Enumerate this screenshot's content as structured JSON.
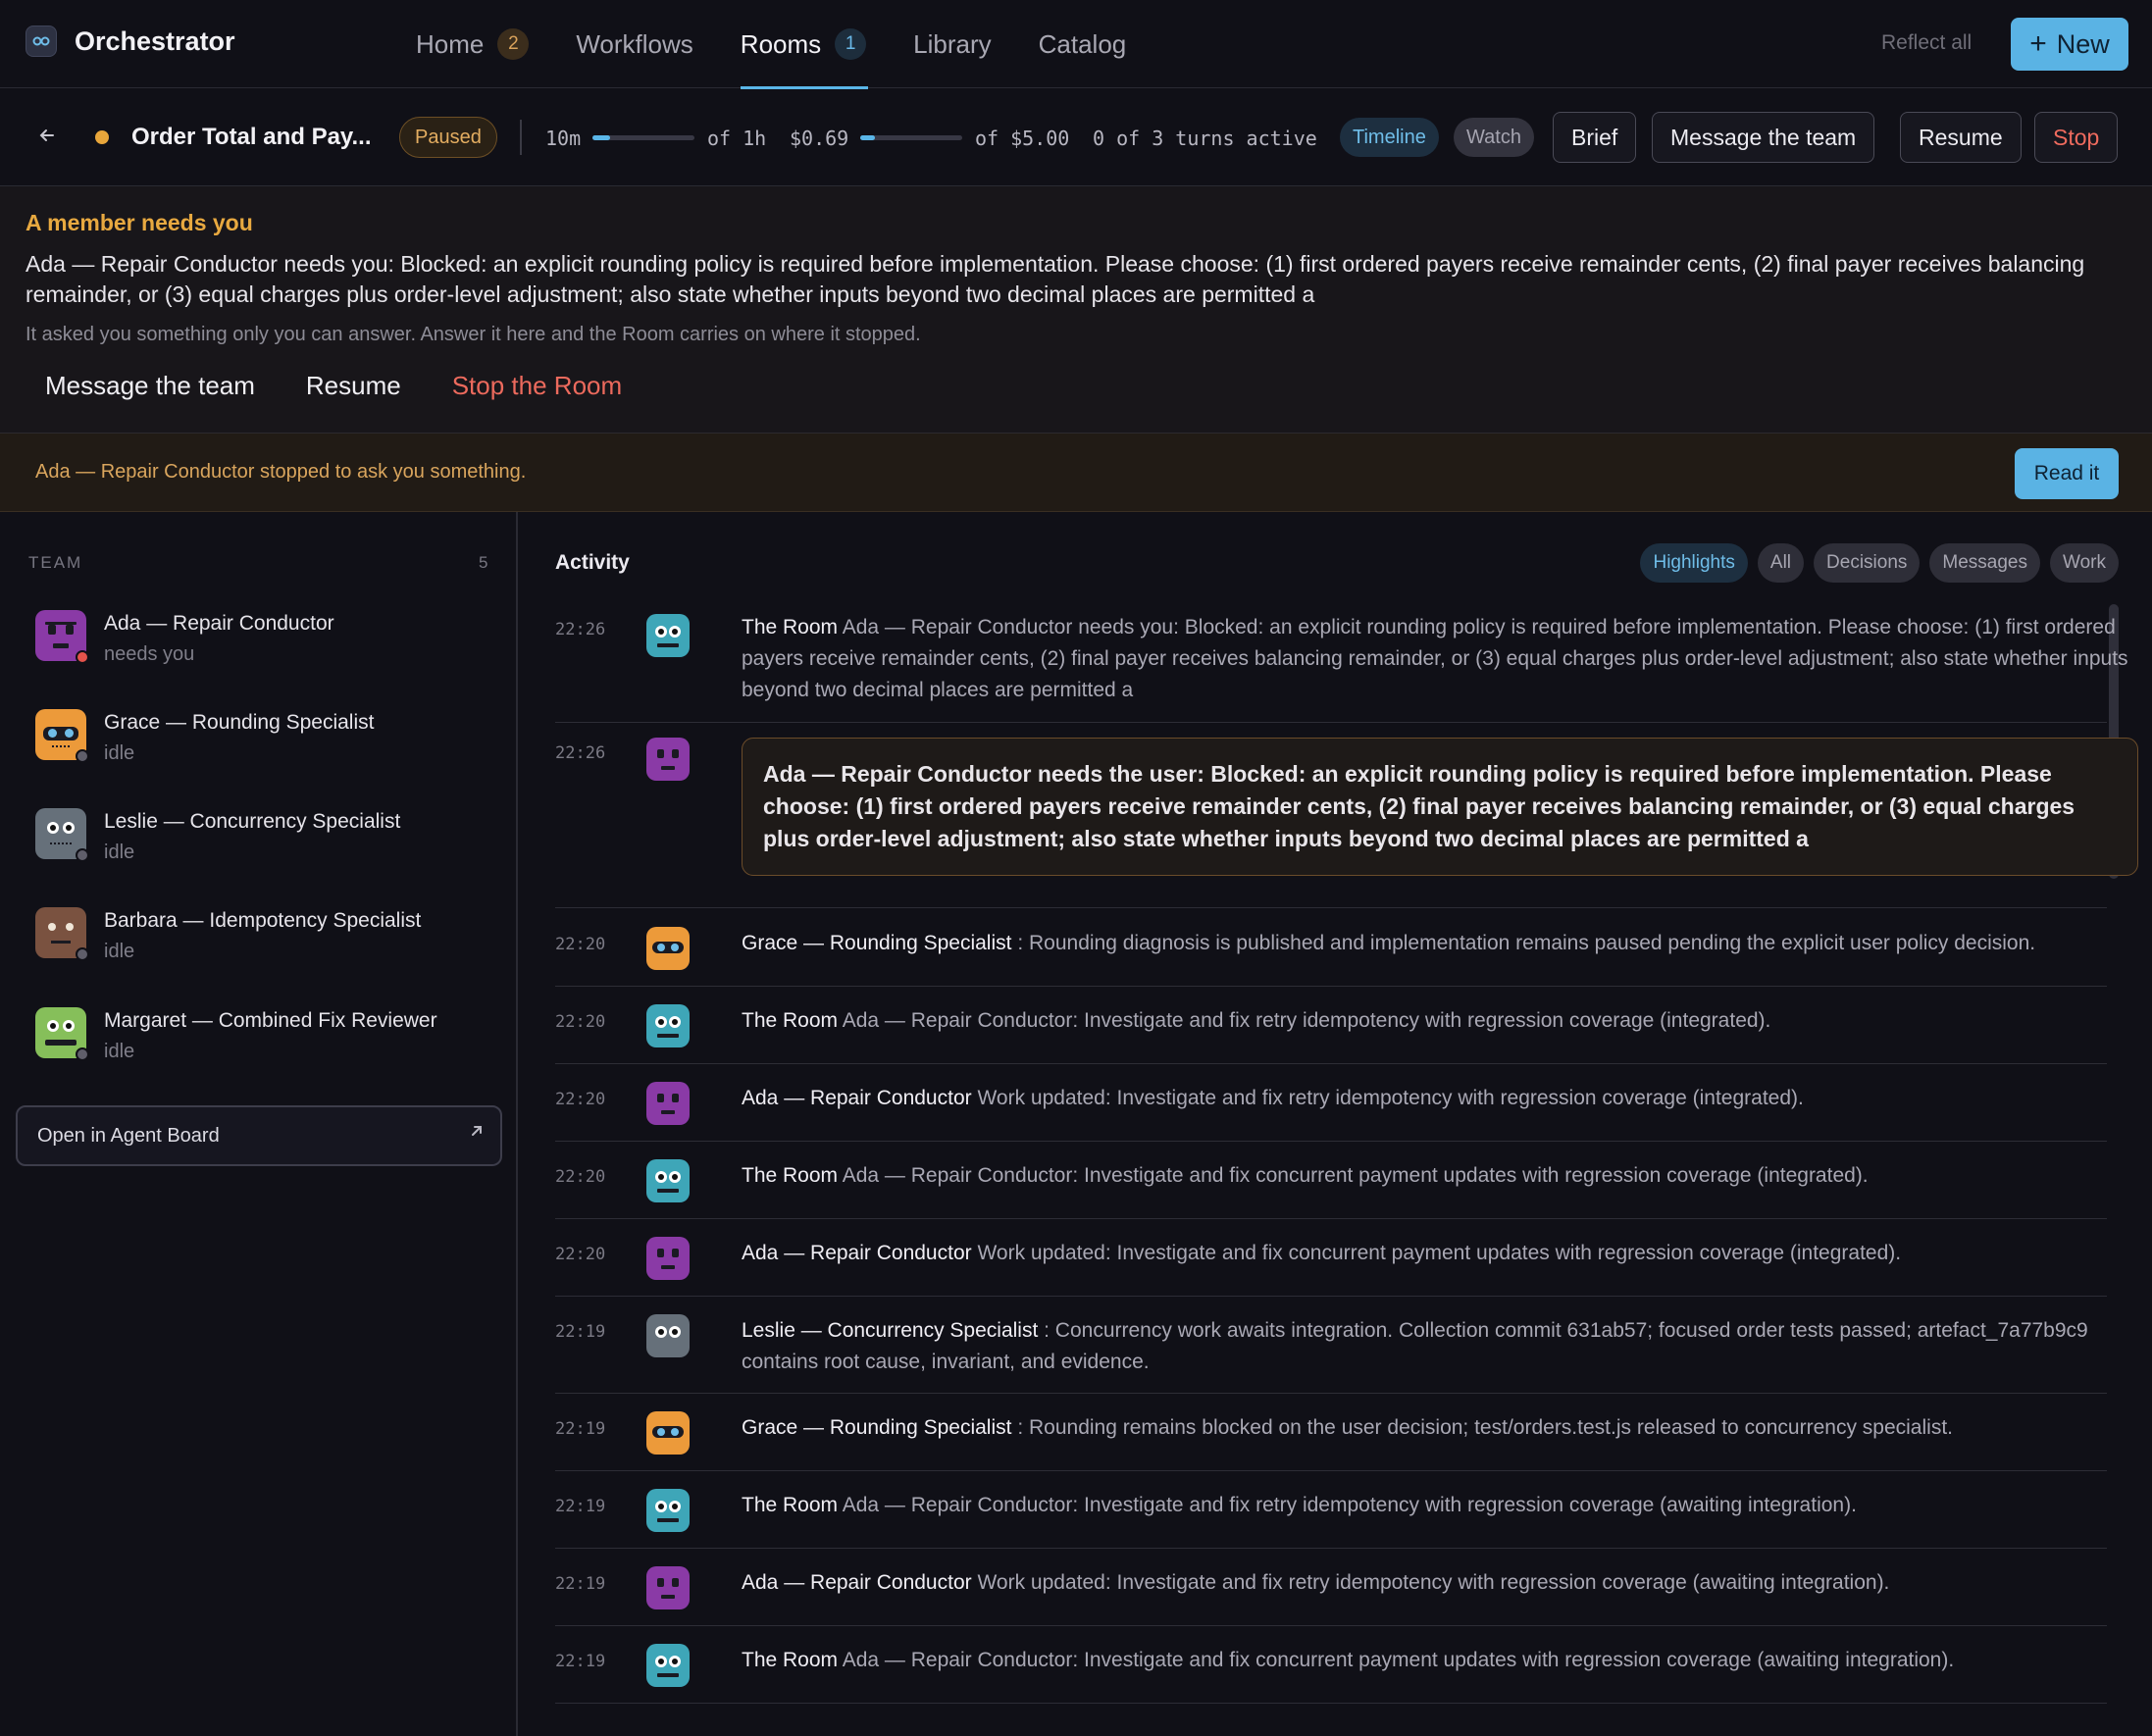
{
  "nav": {
    "brand": "Orchestrator",
    "tabs": [
      {
        "label": "Home",
        "badge": "2"
      },
      {
        "label": "Workflows"
      },
      {
        "label": "Rooms",
        "badge": "1"
      },
      {
        "label": "Library"
      },
      {
        "label": "Catalog"
      }
    ],
    "active_tab": "Rooms",
    "reflect_all": "Reflect all",
    "new_label": "New"
  },
  "room": {
    "title": "Order Total and Pay...",
    "status": "Paused",
    "time_used": "10m",
    "time_limit": "of 1h",
    "time_progress": 0.17,
    "cost_used": "$0.69",
    "cost_limit": "of $5.00",
    "cost_progress": 0.14,
    "turns": "0 of 3 turns active",
    "timeline": "Timeline",
    "watch": "Watch",
    "brief": "Brief",
    "message_team": "Message the team",
    "resume": "Resume",
    "stop": "Stop"
  },
  "alert": {
    "heading": "A member needs you",
    "message": "Ada — Repair Conductor needs you: Blocked: an explicit rounding policy is required before implementation. Please choose: (1) first ordered payers receive remainder cents, (2) final payer receives balancing remainder, or (3) equal charges plus order-level adjustment; also state whether inputs beyond two decimal places are permitted a",
    "sub": "It asked you something only you can answer. Answer it here and the Room carries on where it stopped.",
    "actions": [
      "Message the team",
      "Resume",
      "Stop the Room"
    ]
  },
  "notice": {
    "text": "Ada — Repair Conductor stopped to ask you something.",
    "button": "Read it"
  },
  "team": {
    "heading": "TEAM",
    "count": "5",
    "members": [
      {
        "name": "Ada — Repair Conductor",
        "status": "needs you"
      },
      {
        "name": "Grace — Rounding Specialist",
        "status": "idle"
      },
      {
        "name": "Leslie — Concurrency Specialist",
        "status": "idle"
      },
      {
        "name": "Barbara — Idempotency Specialist",
        "status": "idle"
      },
      {
        "name": "Margaret — Combined Fix Reviewer",
        "status": "idle"
      }
    ],
    "agent_board": "Open in Agent Board"
  },
  "activity": {
    "heading": "Activity",
    "filters": [
      "Highlights",
      "All",
      "Decisions",
      "Messages",
      "Work"
    ],
    "active_filter": "Highlights",
    "rows": [
      {
        "time": "22:26",
        "who": "The Room",
        "text": "Ada — Repair Conductor needs you: Blocked: an explicit rounding policy is required before implementation. Please choose: (1) first ordered payers receive remainder cents, (2) final payer receives balancing remainder, or (3) equal charges plus order-level adjustment; also state whether inputs beyond two decimal places are permitted a"
      },
      {
        "time": "22:26",
        "who": "",
        "text": "Ada — Repair Conductor needs the user: Blocked: an explicit rounding policy is required before implementation. Please choose: (1) first ordered payers receive remainder cents, (2) final payer receives balancing remainder, or (3) equal charges plus order-level adjustment; also state whether inputs beyond two decimal places are permitted a"
      },
      {
        "time": "22:20",
        "who": "Grace — Rounding Specialist",
        "text": ": Rounding diagnosis is published and implementation remains paused pending the explicit user policy decision."
      },
      {
        "time": "22:20",
        "who": "The Room",
        "text": "Ada — Repair Conductor: Investigate and fix retry idempotency with regression coverage (integrated)."
      },
      {
        "time": "22:20",
        "who": "Ada — Repair Conductor",
        "text": "Work updated: Investigate and fix retry idempotency with regression coverage (integrated)."
      },
      {
        "time": "22:20",
        "who": "The Room",
        "text": "Ada — Repair Conductor: Investigate and fix concurrent payment updates with regression coverage (integrated)."
      },
      {
        "time": "22:20",
        "who": "Ada — Repair Conductor",
        "text": "Work updated: Investigate and fix concurrent payment updates with regression coverage (integrated)."
      },
      {
        "time": "22:19",
        "who": "Leslie — Concurrency Specialist",
        "text": ": Concurrency work awaits integration. Collection commit 631ab57; focused order tests passed; artefact_7a77b9c9 contains root cause, invariant, and evidence."
      },
      {
        "time": "22:19",
        "who": "Grace — Rounding Specialist",
        "text": ": Rounding remains blocked on the user decision; test/orders.test.js released to concurrency specialist."
      },
      {
        "time": "22:19",
        "who": "The Room",
        "text": "Ada — Repair Conductor: Investigate and fix retry idempotency with regression coverage (awaiting integration)."
      },
      {
        "time": "22:19",
        "who": "Ada — Repair Conductor",
        "text": "Work updated: Investigate and fix retry idempotency with regression coverage (awaiting integration)."
      },
      {
        "time": "22:19",
        "who": "The Room",
        "text": "Ada — Repair Conductor: Investigate and fix concurrent payment updates with regression coverage (awaiting integration)."
      }
    ]
  },
  "colors": {
    "accent": "#5ab3e4",
    "warning": "#e8a940",
    "danger": "#ec6a5d",
    "avatar_ada": "#8a3aa6",
    "avatar_grace": "#ec9a3a",
    "avatar_leslie": "#66707a",
    "avatar_barbara": "#7a5240",
    "avatar_margaret": "#86bf5a",
    "avatar_room": "#3ea6b8"
  }
}
